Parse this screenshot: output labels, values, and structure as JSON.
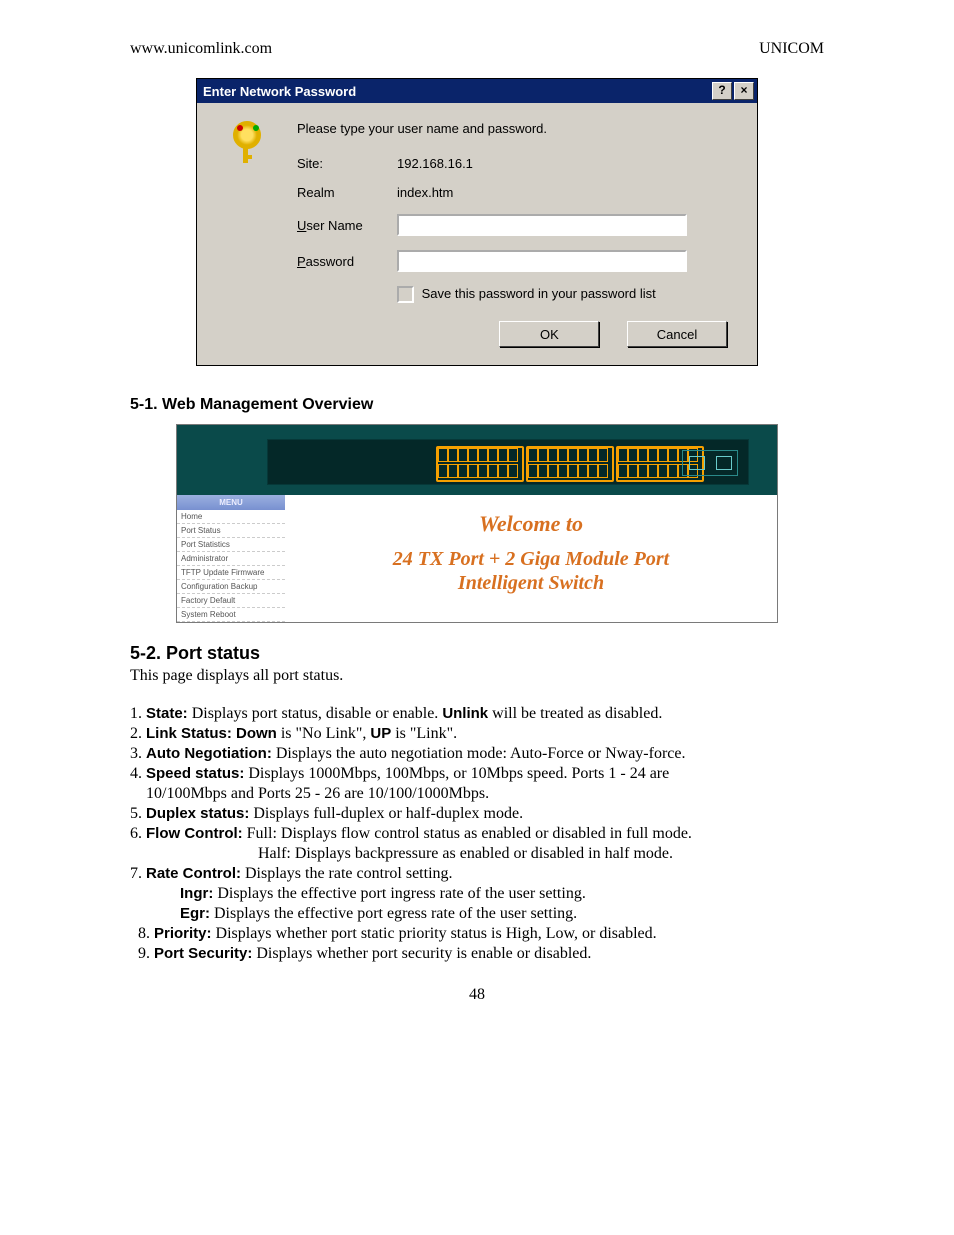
{
  "header": {
    "left": "www.unicomlink.com",
    "right": "UNICOM"
  },
  "dialog": {
    "title": "Enter Network Password",
    "help_btn": "?",
    "close_btn": "×",
    "instruction": "Please type your user name and password.",
    "site_label": "Site:",
    "site_value": "192.168.16.1",
    "realm_label": "Realm",
    "realm_value": "index.htm",
    "username_label_pre": "U",
    "username_label_post": "ser Name",
    "username_value": "",
    "password_label_pre": "P",
    "password_label_post": "assword",
    "password_value": "",
    "save_pre": "S",
    "save_post": "ave this password in your password list",
    "ok": "OK",
    "cancel": "Cancel"
  },
  "section_51": "5-1. Web Management Overview",
  "mgmt": {
    "menu_title": "MENU",
    "menu_items": [
      "Home",
      "Port Status",
      "Port Statistics",
      "Administrator",
      "TFTP Update Firmware",
      "Configuration Backup",
      "Factory Default",
      "System Reboot"
    ],
    "welcome": "Welcome to",
    "product_line1": "24 TX Port + 2 Giga Module Port",
    "product_line2": "Intelligent Switch"
  },
  "section_52": {
    "title": "5-2. Port status",
    "intro": "This page displays all port status.",
    "items": [
      {
        "n": "1.",
        "b": "State:",
        "t": " Displays port status, disable or enable. ",
        "b2": "Unlink",
        "t2": " will be treated as disabled."
      },
      {
        "n": "2.",
        "b": "Link Status: Down",
        "t": " is \"No Link\", ",
        "b2": "UP",
        "t2": " is \"Link\"."
      },
      {
        "n": "3.",
        "b": "Auto Negotiation:",
        "t": " Displays the auto negotiation mode: Auto-Force or Nway-force."
      },
      {
        "n": "4.",
        "b": "Speed status:",
        "t": " Displays 1000Mbps, 100Mbps, or 10Mbps speed. Ports 1 - 24 are",
        "cont": "    10/100Mbps and Ports 25 - 26 are 10/100/1000Mbps."
      },
      {
        "n": "5.",
        "b": "Duplex status:",
        "t": " Displays full-duplex or half-duplex mode."
      },
      {
        "n": "6.",
        "b": "Flow Control:",
        "t": "  Full: Displays flow control status as enabled or disabled in full mode.",
        "sub": "Half:  Displays backpressure as enabled or disabled in half mode."
      },
      {
        "n": "7.",
        "b": "Rate Control:",
        "t": " Displays the rate control setting.",
        "sub2a_b": "Ingr:",
        "sub2a_t": "  Displays the effective port ingress rate of the user setting.",
        "sub2b_b": "Egr:",
        "sub2b_t": "  Displays the effective port egress rate of the user setting."
      },
      {
        "n": "8.",
        "pre": "  ",
        "b": "Priority:",
        "t": " Displays whether port static priority status is High, Low, or disabled."
      },
      {
        "n": "9.",
        "pre": "  ",
        "b": "Port Security:",
        "t": " Displays whether port security is enable or disabled."
      }
    ]
  },
  "page_number": "48"
}
